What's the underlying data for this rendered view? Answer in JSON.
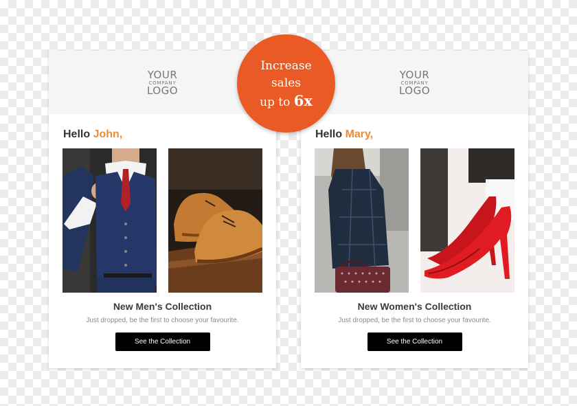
{
  "badge": {
    "line1": "Increase",
    "line2": "sales",
    "line3_prefix": "up to",
    "line3_value": "6x"
  },
  "logo": {
    "line1": "YOUR",
    "line2": "COMPANY",
    "line3": "LOGO"
  },
  "cards": [
    {
      "greeting": "Hello",
      "name": "John,",
      "collection_title": "New Men's Collection",
      "subtitle": "Just dropped, be the first to choose your favourite.",
      "button_label": "See the Collection"
    },
    {
      "greeting": "Hello",
      "name": "Mary,",
      "collection_title": "New Women's Collection",
      "subtitle": "Just dropped, be the first to choose your favourite.",
      "button_label": "See the Collection"
    }
  ],
  "colors": {
    "accent": "#f08a33",
    "badge": "#ea5a24",
    "button": "#000000"
  }
}
